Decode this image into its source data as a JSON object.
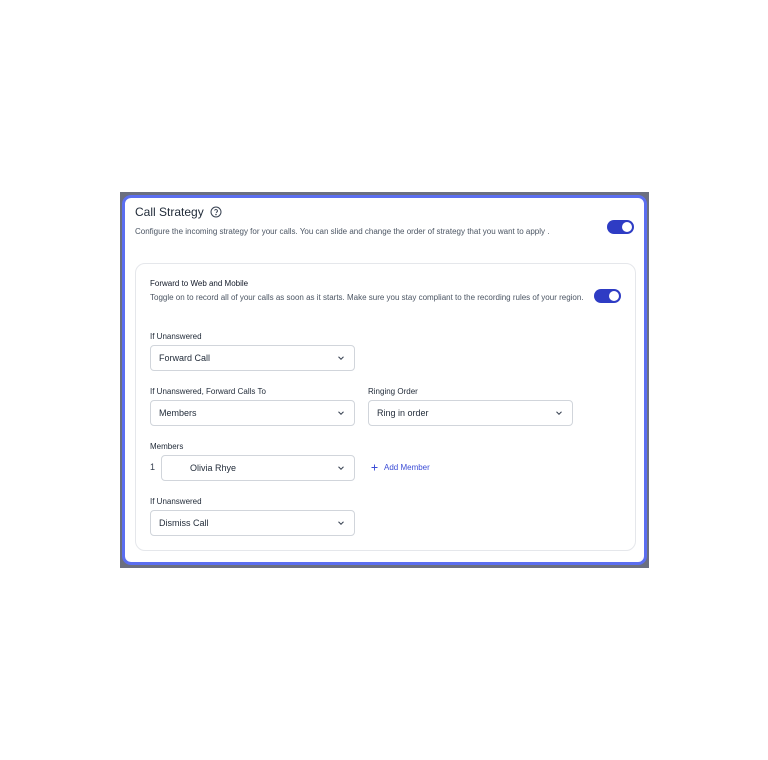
{
  "strategy": {
    "title": "Call Strategy",
    "description": "Configure the incoming strategy for your calls. You can slide and change the order of strategy that you want to apply .",
    "enabled": true
  },
  "forward": {
    "title": "Forward to Web and Mobile",
    "description": "Toggle on to record all of your calls as soon as it starts. Make sure you stay compliant to the recording rules of your region.",
    "enabled": true
  },
  "if_unanswered_1": {
    "label": "If Unanswered",
    "value": "Forward Call"
  },
  "forward_to": {
    "label": "If Unanswered, Forward Calls To",
    "value": "Members"
  },
  "ringing_order": {
    "label": "Ringing Order",
    "value": "Ring in order"
  },
  "members": {
    "label": "Members",
    "items": [
      {
        "index": "1",
        "name": "Olivia Rhye"
      }
    ],
    "add_label": "Add Member"
  },
  "if_unanswered_2": {
    "label": "If Unanswered",
    "value": "Dismiss Call"
  },
  "colors": {
    "accent": "#2e3cc4",
    "border": "#5b6ef0",
    "link": "#3b4cd6"
  }
}
